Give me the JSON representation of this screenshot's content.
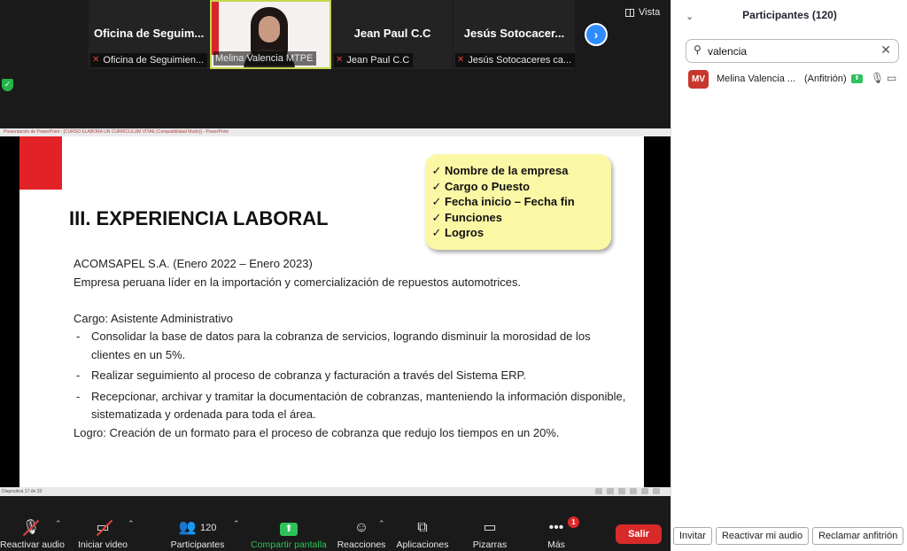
{
  "video_strip": {
    "tiles": [
      {
        "big_name": "Oficina  de  Seguim...",
        "label": "Oficina de Seguimien..."
      },
      {
        "label": "Melina Valencia MTPE"
      },
      {
        "big_name": "Jean Paul C.C",
        "label": "Jean Paul C.C"
      },
      {
        "big_name": "Jesús  Sotocacer...",
        "label": "Jesús Sotocaceres ca..."
      }
    ],
    "view_label": "Vista"
  },
  "share": {
    "window_title": "Presentación de PowerPoint - [CURSO ELABORA UN CURRICULUM VITAE (Compatibilidad Modo)] - PowerPoint",
    "status_text": "Diapositiva 17 de 33"
  },
  "slide": {
    "title": "III. EXPERIENCIA LABORAL",
    "checklist": [
      "Nombre de la empresa",
      "Cargo o Puesto",
      "Fecha inicio – Fecha fin",
      "Funciones",
      "Logros"
    ],
    "company": "ACOMSAPEL S.A.",
    "dates": "(Enero 2022 – Enero 2023)",
    "company_desc": "Empresa peruana líder en la importación y comercialización de repuestos automotrices.",
    "position_label": "Cargo:",
    "position": "Asistente Administrativo",
    "bullets": [
      "Consolidar la base de datos para la cobranza de servicios, logrando disminuir la morosidad de los clientes en un 5%.",
      "Realizar seguimiento al proceso de cobranza y facturación a través del Sistema ERP.",
      "Recepcionar, archivar y tramitar la documentación de cobranzas, manteniendo la información disponible, sistematizada y ordenada para toda el área."
    ],
    "achievement_label": "Logro:",
    "achievement": "Creación de un formato para el proceso de cobranza que redujo los tiempos en un 20%."
  },
  "toolbar": {
    "mic_label": "Reactivar audio",
    "video_label": "Iniciar video",
    "participants_label": "Participantes",
    "participants_count": "120",
    "share_label": "Compartir pantalla",
    "reactions_label": "Reacciones",
    "apps_label": "Aplicaciones",
    "whiteboards_label": "Pizarras",
    "more_label": "Más",
    "more_badge": "1",
    "leave_label": "Salir"
  },
  "panel": {
    "title": "Participantes (120)",
    "search_value": "valencia",
    "participant": {
      "initials": "MV",
      "name": "Melina Valencia ...",
      "role": "(Anfitrión)",
      "avatar_color": "#c8372d"
    },
    "buttons": {
      "invite": "Invitar",
      "unmute": "Reactivar mi audio",
      "claim_host": "Reclamar anfitrión"
    }
  }
}
